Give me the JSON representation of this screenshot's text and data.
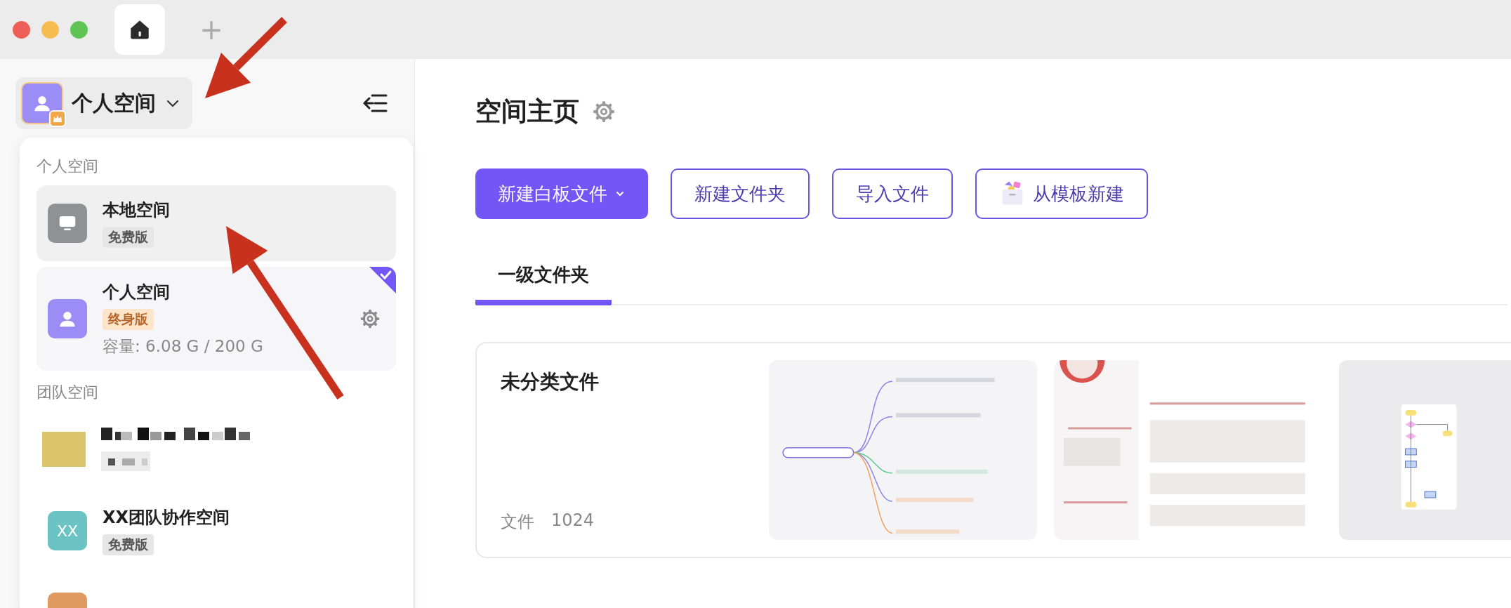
{
  "window": {
    "tabs": [
      {
        "kind": "home",
        "selected": true
      },
      {
        "kind": "add",
        "label": "+",
        "selected": false
      }
    ]
  },
  "sidebar": {
    "switcher": {
      "label": "个人空间",
      "expanded": true
    },
    "dropdown": {
      "sections": [
        {
          "title": "个人空间",
          "items": [
            {
              "kind": "local",
              "name": "本地空间",
              "badge": "免费版",
              "badge_highlight": false,
              "hovered": true,
              "selected": false
            },
            {
              "kind": "personal",
              "name": "个人空间",
              "badge": "终身版",
              "badge_highlight": true,
              "capacity": "容量: 6.08 G / 200 G",
              "hovered": false,
              "selected": true
            }
          ]
        },
        {
          "title": "团队空间",
          "items": [
            {
              "kind": "redacted",
              "color": "#dcc46c",
              "hovered": false,
              "selected": false
            },
            {
              "kind": "team",
              "avatar": "XX",
              "name": "XX团队协作空间",
              "badge": "免费版",
              "badge_highlight": false,
              "color": "#6cc3c3",
              "hovered": false,
              "selected": false
            },
            {
              "kind": "team",
              "color": "#e0995f",
              "hovered": false,
              "selected": false
            }
          ]
        }
      ]
    }
  },
  "main": {
    "title": "空间主页",
    "buttons": [
      {
        "label": "新建白板文件",
        "kind": "primary",
        "dropdown": true
      },
      {
        "label": "新建文件夹",
        "kind": "outline"
      },
      {
        "label": "导入文件",
        "kind": "outline"
      },
      {
        "label": "从模板新建",
        "kind": "outline",
        "icon": true
      }
    ],
    "tabs": [
      {
        "label": "一级文件夹",
        "selected": true
      }
    ],
    "folders": [
      {
        "title": "未分类文件",
        "count_label": "文件",
        "count": "1024"
      }
    ]
  },
  "annotations": [
    {
      "kind": "arrow"
    },
    {
      "kind": "arrow"
    }
  ]
}
